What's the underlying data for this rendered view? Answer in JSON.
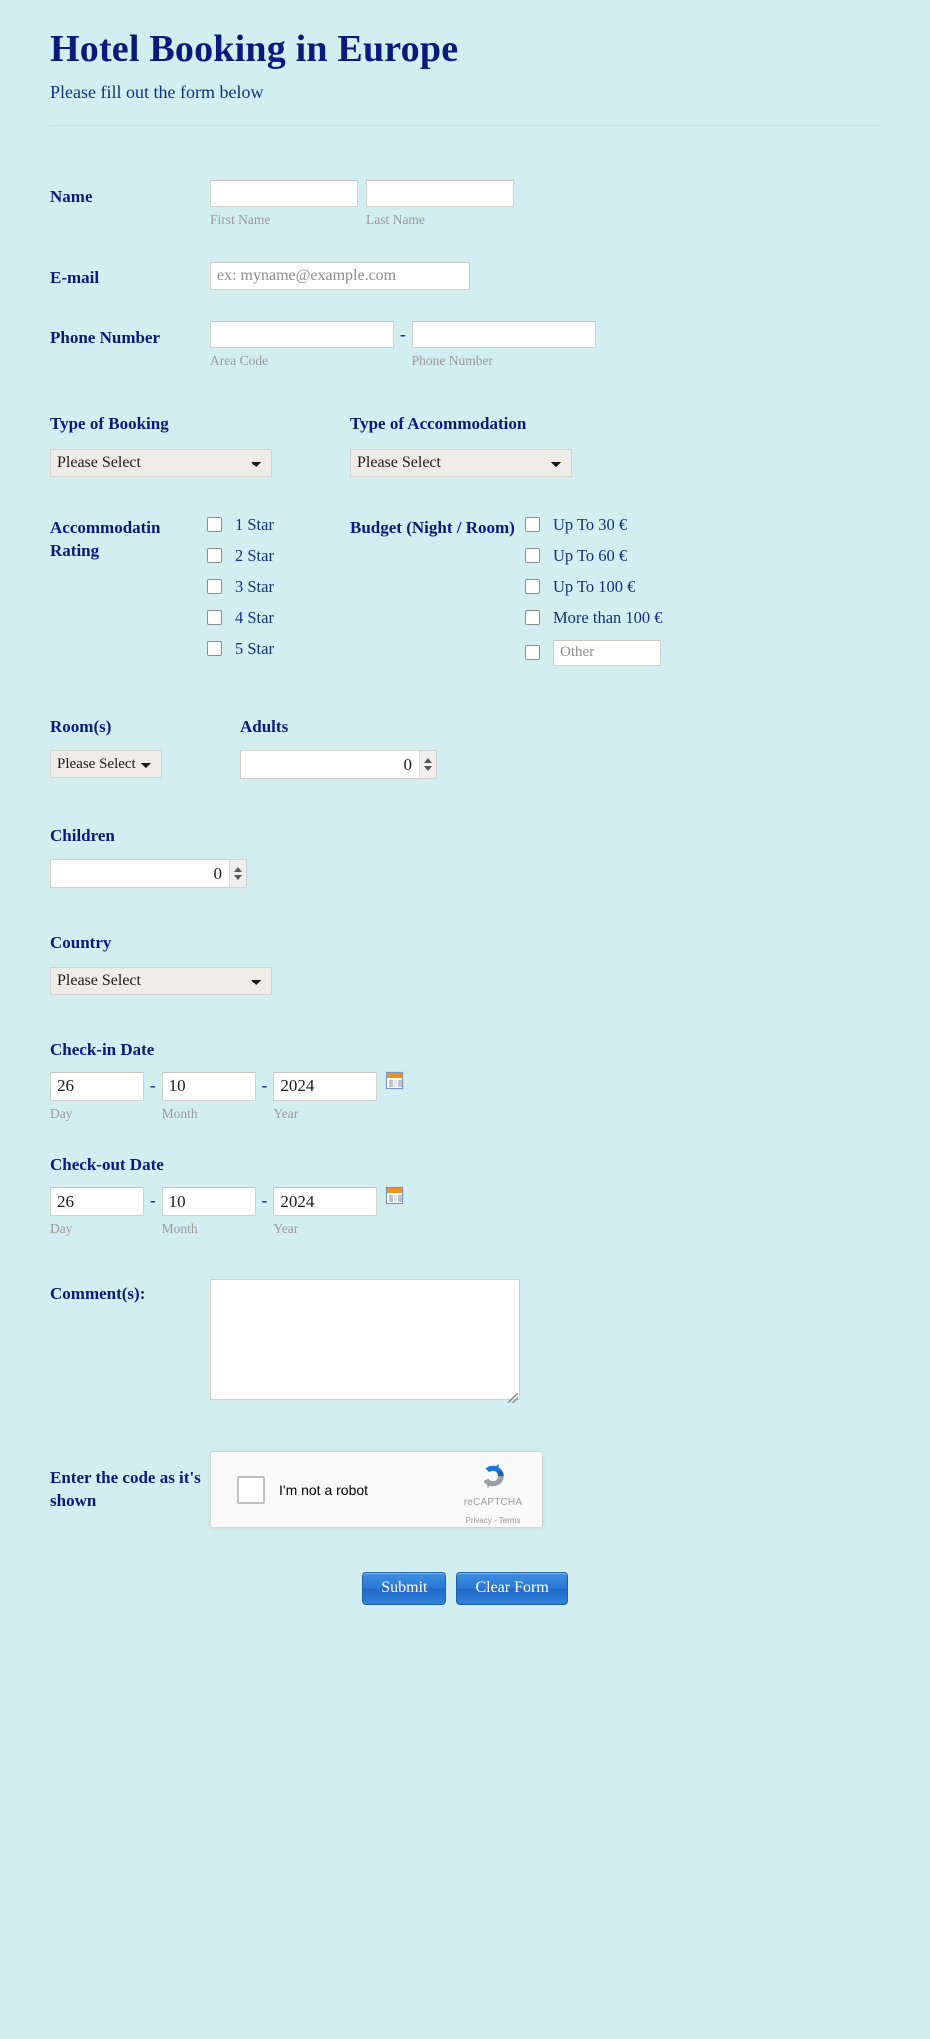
{
  "header": {
    "title": "Hotel Booking in Europe",
    "subtitle": "Please fill out the form below"
  },
  "fields": {
    "name": {
      "label": "Name",
      "first_sub": "First Name",
      "last_sub": "Last Name",
      "first_value": "",
      "last_value": ""
    },
    "email": {
      "label": "E-mail",
      "placeholder": "ex: myname@example.com",
      "value": ""
    },
    "phone": {
      "label": "Phone Number",
      "area_sub": "Area Code",
      "number_sub": "Phone Number",
      "separator": "-",
      "area_value": "",
      "number_value": ""
    },
    "type_of_booking": {
      "label": "Type of Booking",
      "selected": "Please Select"
    },
    "type_of_accommodation": {
      "label": "Type of Accommodation",
      "selected": "Please Select"
    },
    "accommodation_rating": {
      "label": "Accommodatin Rating",
      "options": [
        "1 Star",
        "2 Star",
        "3 Star",
        "4 Star",
        "5 Star"
      ]
    },
    "budget": {
      "label": "Budget (Night / Room)",
      "options": [
        "Up To 30 €",
        "Up To 60 €",
        "Up To 100 €",
        "More than 100 €"
      ],
      "other_placeholder": "Other",
      "other_value": ""
    },
    "rooms": {
      "label": "Room(s)",
      "selected": "Please Select"
    },
    "adults": {
      "label": "Adults",
      "value": "0"
    },
    "children": {
      "label": "Children",
      "value": "0"
    },
    "country": {
      "label": "Country",
      "selected": "Please Select"
    },
    "checkin": {
      "label": "Check-in Date",
      "day": "26",
      "month": "10",
      "year": "2024",
      "day_sub": "Day",
      "month_sub": "Month",
      "year_sub": "Year",
      "separator": "-"
    },
    "checkout": {
      "label": "Check-out Date",
      "day": "26",
      "month": "10",
      "year": "2024",
      "day_sub": "Day",
      "month_sub": "Month",
      "year_sub": "Year",
      "separator": "-"
    },
    "comments": {
      "label": "Comment(s):",
      "value": ""
    },
    "captcha": {
      "label": "Enter the code as it's shown",
      "checkbox_text": "I'm not a robot",
      "brand": "reCAPTCHA",
      "links": "Privacy - Terms"
    }
  },
  "buttons": {
    "submit": "Submit",
    "clear": "Clear Form"
  },
  "colors": {
    "page_background": "#d2eef1",
    "heading": "#0a1a7a",
    "label_text": "#16307a",
    "sublabel_text": "#9a9a9a",
    "button_blue": "#2a78d6",
    "recaptcha_blue": "#1c77d4",
    "calendar_orange": "#f0901e"
  }
}
